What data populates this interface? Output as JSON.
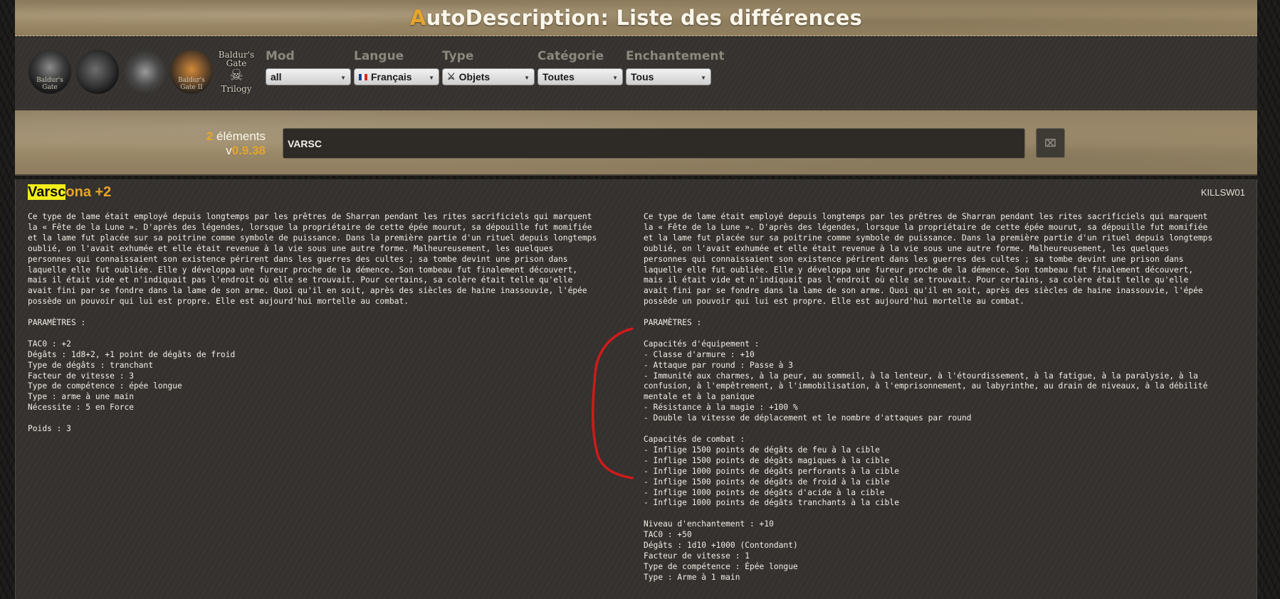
{
  "header": {
    "title_accent": "A",
    "title_rest": "utoDescription: Liste des différences"
  },
  "logos": [
    {
      "name": "Baldur's Gate",
      "caption": "Baldur's Gate"
    },
    {
      "name": "Shadows of Amn"
    },
    {
      "name": "Throne of Bhaal"
    },
    {
      "name": "Baldur's Gate II",
      "caption": "Baldur's Gate II"
    },
    {
      "name": "Baldur's Gate Trilogy",
      "line1": "Baldur's",
      "line2": "Gate",
      "line3": "Trilogy"
    }
  ],
  "filters": {
    "mod": {
      "label": "Mod",
      "value": "all"
    },
    "langue": {
      "label": "Langue",
      "value": "Français"
    },
    "type": {
      "label": "Type",
      "value": "Objets"
    },
    "categorie": {
      "label": "Catégorie",
      "value": "Toutes"
    },
    "enchantement": {
      "label": "Enchantement",
      "value": "Tous"
    }
  },
  "search": {
    "count_num": "2",
    "count_label": " éléments",
    "version_prefix": "v",
    "version": "0.9.38",
    "query": "VARSC",
    "clear_label": "⌧"
  },
  "item": {
    "title_highlight": "Varsc",
    "title_rest": "ona +2",
    "code": "KILLSW01",
    "left_lines": [
      "Ce type de lame était employé depuis longtemps par les prêtres de Sharran pendant les rites sacrificiels qui marquent",
      "la « Fête de la Lune ». D'après des légendes, lorsque la propriétaire de cette épée mourut, sa dépouille fut momifiée",
      "et la lame fut placée sur sa poitrine comme symbole de puissance. Dans la première partie d'un rituel depuis longtemps",
      "oublié, on l'avait exhumée et elle était revenue à la vie sous une autre forme. Malheureusement, les quelques",
      "personnes qui connaissaient son existence périrent dans les guerres des cultes ; sa tombe devint une prison dans",
      "laquelle elle fut oubliée. Elle y développa une fureur proche de la démence. Son tombeau fut finalement découvert,",
      "mais il était vide et n'indiquait pas l'endroit où elle se trouvait. Pour certains, sa colère était telle qu'elle",
      "avait fini par se fondre dans la lame de son arme. Quoi qu'il en soit, après des siècles de haine inassouvie, l'épée",
      "possède un pouvoir qui lui est propre. Elle est aujourd'hui mortelle au combat.",
      "",
      "PARAMÈTRES :",
      "",
      "TAC0 : +2",
      "Dégâts : 1d8+2, +1 point de dégâts de froid",
      "Type de dégâts : tranchant",
      "Facteur de vitesse : 3",
      "Type de compétence : épée longue",
      "Type : arme à une main",
      "Nécessite : 5 en Force",
      "",
      "Poids : 3"
    ],
    "right_lines": [
      "Ce type de lame était employé depuis longtemps par les prêtres de Sharran pendant les rites sacrificiels qui marquent",
      "la « Fête de la Lune ». D'après des légendes, lorsque la propriétaire de cette épée mourut, sa dépouille fut momifiée",
      "et la lame fut placée sur sa poitrine comme symbole de puissance. Dans la première partie d'un rituel depuis longtemps",
      "oublié, on l'avait exhumée et elle était revenue à la vie sous une autre forme. Malheureusement, les quelques",
      "personnes qui connaissaient son existence périrent dans les guerres des cultes ; sa tombe devint une prison dans",
      "laquelle elle fut oubliée. Elle y développa une fureur proche de la démence. Son tombeau fut finalement découvert,",
      "mais il était vide et n'indiquait pas l'endroit où elle se trouvait. Pour certains, sa colère était telle qu'elle",
      "avait fini par se fondre dans la lame de son arme. Quoi qu'il en soit, après des siècles de haine inassouvie, l'épée",
      "possède un pouvoir qui lui est propre. Elle est aujourd'hui mortelle au combat.",
      "",
      "PARAMÈTRES :",
      "",
      "Capacités d'équipement :",
      "- Classe d'armure : +10",
      "- Attaque par round : Passe à 3",
      "- Immunité aux charmes, à la peur, au sommeil, à la lenteur, à l'étourdissement, à la fatigue, à la paralysie, à la",
      "confusion, à l'empêtrement, à l'immobilisation, à l'emprisonnement, au labyrinthe, au drain de niveaux, à la débilité",
      "mentale et à la panique",
      "- Résistance à la magie : +100 %",
      "- Double la vitesse de déplacement et le nombre d'attaques par round",
      "",
      "Capacités de combat :",
      "- Inflige 1500 points de dégâts de feu à la cible",
      "- Inflige 1500 points de dégâts magiques à la cible",
      "- Inflige 1000 points de dégâts perforants à la cible",
      "- Inflige 1500 points de dégâts de froid à la cible",
      "- Inflige 1000 points de dégâts d'acide à la cible",
      "- Inflige 1000 points de dégâts tranchants à la cible",
      "",
      "Niveau d'enchantement : +10",
      "TAC0 : +50",
      "Dégâts : 1d10 +1000 (Contondant)",
      "Facteur de vitesse : 1",
      "Type de compétence : Épée longue",
      "Type : Arme à 1 main"
    ]
  },
  "colors": {
    "accent": "#e7a52a",
    "highlight": "#f1ee1b",
    "annotation": "#d11a1a"
  }
}
